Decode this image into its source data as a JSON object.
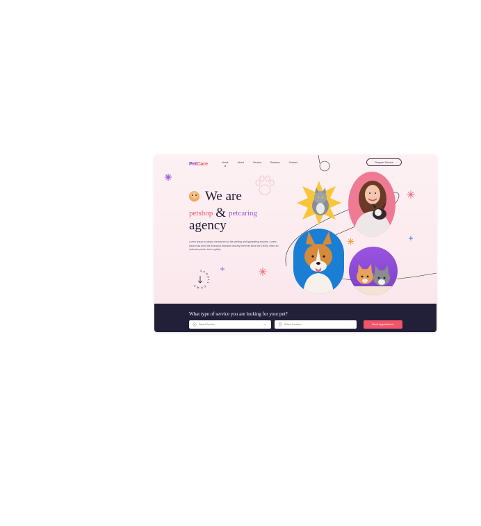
{
  "header": {
    "logo_part1": "Pet",
    "logo_part2": "Care",
    "nav": [
      "Home",
      "About",
      "Service",
      "Reviews",
      "Contact"
    ],
    "active_nav": "Home",
    "cta_label": "Request Service"
  },
  "hero": {
    "line1": "We are",
    "line2_a": "petshop",
    "line2_amp": "&",
    "line2_b": "petcaring",
    "line3": "agency",
    "description": "Lorem Ipsum is simply dummy text of the printing and typesetting industry. Lorem Ipsum has been the industry's standard dummy text ever since the 1500s, when an unknown printer took a galley.",
    "scroll_text": "SCROLL DOWN"
  },
  "search": {
    "question": "What type of service you are looking for your pet?",
    "service_placeholder": "Select Service",
    "location_placeholder": "Select Location",
    "submit_label": "Book Appointment"
  },
  "colors": {
    "brand_purple": "#7e3fd8",
    "brand_coral": "#f0566a",
    "dark_navy": "#221f38",
    "hero_bg": "#fbe9ee"
  },
  "icons": [
    "pet-face-emoji-icon",
    "paw-icon",
    "sparkle-icon",
    "star-icon",
    "plus-icon",
    "scroll-arrow-icon",
    "service-icon",
    "location-pin-icon",
    "chevron-down-icon"
  ]
}
